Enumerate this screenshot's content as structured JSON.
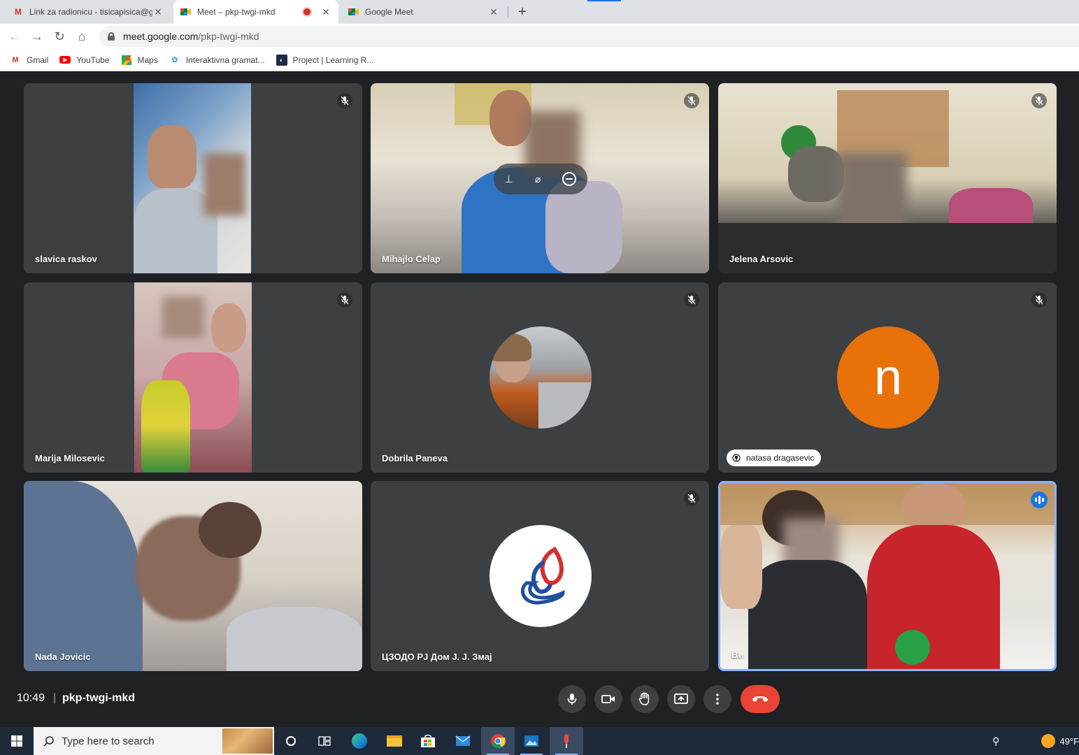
{
  "browser": {
    "tabs": [
      {
        "title": "Link za radionicu - tisicapisica@g",
        "icon": "gmail-icon"
      },
      {
        "title": "Meet – pkp-twgi-mkd",
        "icon": "meet-icon",
        "recording": true
      },
      {
        "title": "Google Meet",
        "icon": "meet-icon"
      }
    ],
    "url_host": "meet.google.com",
    "url_path": "/pkp-twgi-mkd",
    "bookmarks": [
      {
        "label": "Gmail",
        "icon": "gmail-icon"
      },
      {
        "label": "YouTube",
        "icon": "youtube-icon"
      },
      {
        "label": "Maps",
        "icon": "maps-icon"
      },
      {
        "label": "Interaktivna gramat...",
        "icon": "globe-icon"
      },
      {
        "label": "Project | Learning R...",
        "icon": "project-icon"
      }
    ]
  },
  "meeting": {
    "participants": [
      {
        "name": "slavica raskov",
        "muted": true
      },
      {
        "name": "Mihajlo Celap",
        "muted": true
      },
      {
        "name": "Jelena Arsovic",
        "muted": true
      },
      {
        "name": "Marija Milosevic",
        "muted": true
      },
      {
        "name": "Dobrila Paneva",
        "muted": true
      },
      {
        "name": "natasa dragasevic",
        "muted": true,
        "avatar_letter": "n",
        "avatar_color": "#e8710a",
        "pinned_label": true
      },
      {
        "name": "Nada Jovicic",
        "muted": false
      },
      {
        "name": "ЦЗОДО РЈ Дом Ј. Ј. Змај",
        "muted": true
      },
      {
        "name": "Ви",
        "muted": false,
        "speaking": true
      }
    ],
    "time": "10:49",
    "separator": "|",
    "code": "pkp-twgi-mkd",
    "controls": [
      "mic-icon",
      "camera-icon",
      "raise-hand-icon",
      "present-icon",
      "more-icon",
      "end-call-icon"
    ]
  },
  "taskbar": {
    "search_placeholder": "Type here to search",
    "temperature": "49°F"
  },
  "colors": {
    "background": "#202124",
    "tile": "#3c4043",
    "end_call": "#ea4335",
    "speaking_border": "#8ab4f8",
    "accent": "#1a73e8"
  }
}
